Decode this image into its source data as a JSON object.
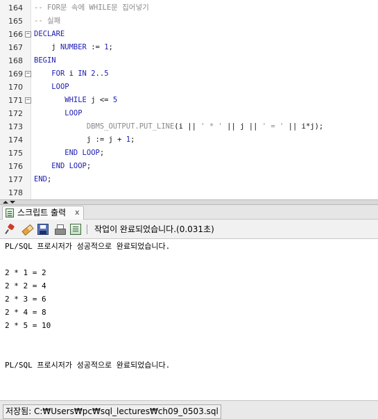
{
  "editor": {
    "lines": [
      {
        "number": "164",
        "fold": "",
        "indent": "",
        "tokens": [
          {
            "t": "-- FOR문 속에 WHILE문 집어넣기",
            "c": "cm"
          }
        ]
      },
      {
        "number": "165",
        "fold": "",
        "indent": "",
        "tokens": [
          {
            "t": "-- 실패",
            "c": "cm"
          }
        ]
      },
      {
        "number": "166",
        "fold": "−",
        "indent": "",
        "tokens": [
          {
            "t": "DECLARE",
            "c": "kw"
          }
        ]
      },
      {
        "number": "167",
        "fold": "",
        "indent": "    ",
        "tokens": [
          {
            "t": "j ",
            "c": "id"
          },
          {
            "t": "NUMBER",
            "c": "kw"
          },
          {
            "t": " := ",
            "c": "id"
          },
          {
            "t": "1",
            "c": "num"
          },
          {
            "t": ";",
            "c": "id"
          }
        ]
      },
      {
        "number": "168",
        "fold": "",
        "indent": "",
        "tokens": [
          {
            "t": "BEGIN",
            "c": "kw"
          }
        ]
      },
      {
        "number": "169",
        "fold": "−",
        "indent": "    ",
        "tokens": [
          {
            "t": "FOR",
            "c": "kw"
          },
          {
            "t": " i ",
            "c": "id"
          },
          {
            "t": "IN",
            "c": "kw"
          },
          {
            "t": " ",
            "c": "id"
          },
          {
            "t": "2",
            "c": "num"
          },
          {
            "t": "..",
            "c": "id"
          },
          {
            "t": "5",
            "c": "num"
          }
        ]
      },
      {
        "number": "170",
        "fold": "",
        "indent": "    ",
        "tokens": [
          {
            "t": "LOOP",
            "c": "kw"
          }
        ]
      },
      {
        "number": "171",
        "fold": "−",
        "indent": "       ",
        "tokens": [
          {
            "t": "WHILE",
            "c": "kw"
          },
          {
            "t": " j <= ",
            "c": "id"
          },
          {
            "t": "5",
            "c": "num"
          }
        ]
      },
      {
        "number": "172",
        "fold": "",
        "indent": "       ",
        "tokens": [
          {
            "t": "LOOP",
            "c": "kw"
          }
        ]
      },
      {
        "number": "173",
        "fold": "",
        "indent": "            ",
        "tokens": [
          {
            "t": "DBMS_OUTPUT.PUT_LINE",
            "c": "fn"
          },
          {
            "t": "(i || ",
            "c": "id"
          },
          {
            "t": "' * '",
            "c": "fn"
          },
          {
            "t": " || j || ",
            "c": "id"
          },
          {
            "t": "' = '",
            "c": "fn"
          },
          {
            "t": " || i*j);",
            "c": "id"
          }
        ]
      },
      {
        "number": "174",
        "fold": "",
        "indent": "            ",
        "tokens": [
          {
            "t": "j := j + ",
            "c": "id"
          },
          {
            "t": "1",
            "c": "num"
          },
          {
            "t": ";",
            "c": "id"
          }
        ]
      },
      {
        "number": "175",
        "fold": "",
        "indent": "       ",
        "tokens": [
          {
            "t": "END LOOP",
            "c": "kw"
          },
          {
            "t": ";",
            "c": "id"
          }
        ]
      },
      {
        "number": "176",
        "fold": "",
        "indent": "    ",
        "tokens": [
          {
            "t": "END LOOP",
            "c": "kw"
          },
          {
            "t": ";",
            "c": "id"
          }
        ]
      },
      {
        "number": "177",
        "fold": "",
        "indent": "",
        "tokens": [
          {
            "t": "END",
            "c": "kw"
          },
          {
            "t": ";",
            "c": "id"
          }
        ]
      },
      {
        "number": "178",
        "fold": "",
        "indent": "",
        "tokens": []
      }
    ]
  },
  "panel": {
    "tab_label": "스크립트 출력",
    "tab_close": "x",
    "tab_icon": "script-output-icon",
    "toolbar": {
      "icons": [
        "pin-icon",
        "eraser-icon",
        "save-icon",
        "print-icon",
        "document-icon"
      ],
      "status": "작업이 완료되었습니다.(0.031초)"
    },
    "output_lines": [
      "PL/SQL 프로시저가 성공적으로 완료되었습니다.",
      "",
      "2 * 1 = 2",
      "2 * 2 = 4",
      "2 * 3 = 6",
      "2 * 4 = 8",
      "2 * 5 = 10",
      "",
      "",
      "PL/SQL 프로시저가 성공적으로 완료되었습니다."
    ]
  },
  "statusbar": {
    "text": "저장됨: C:₩Users₩pc₩sql_lectures₩ch09_0503.sql"
  },
  "colors": {
    "keyword": "#1a1ab0",
    "comment": "#8a8a8a",
    "gutter_bg": "#f4f4f4"
  }
}
